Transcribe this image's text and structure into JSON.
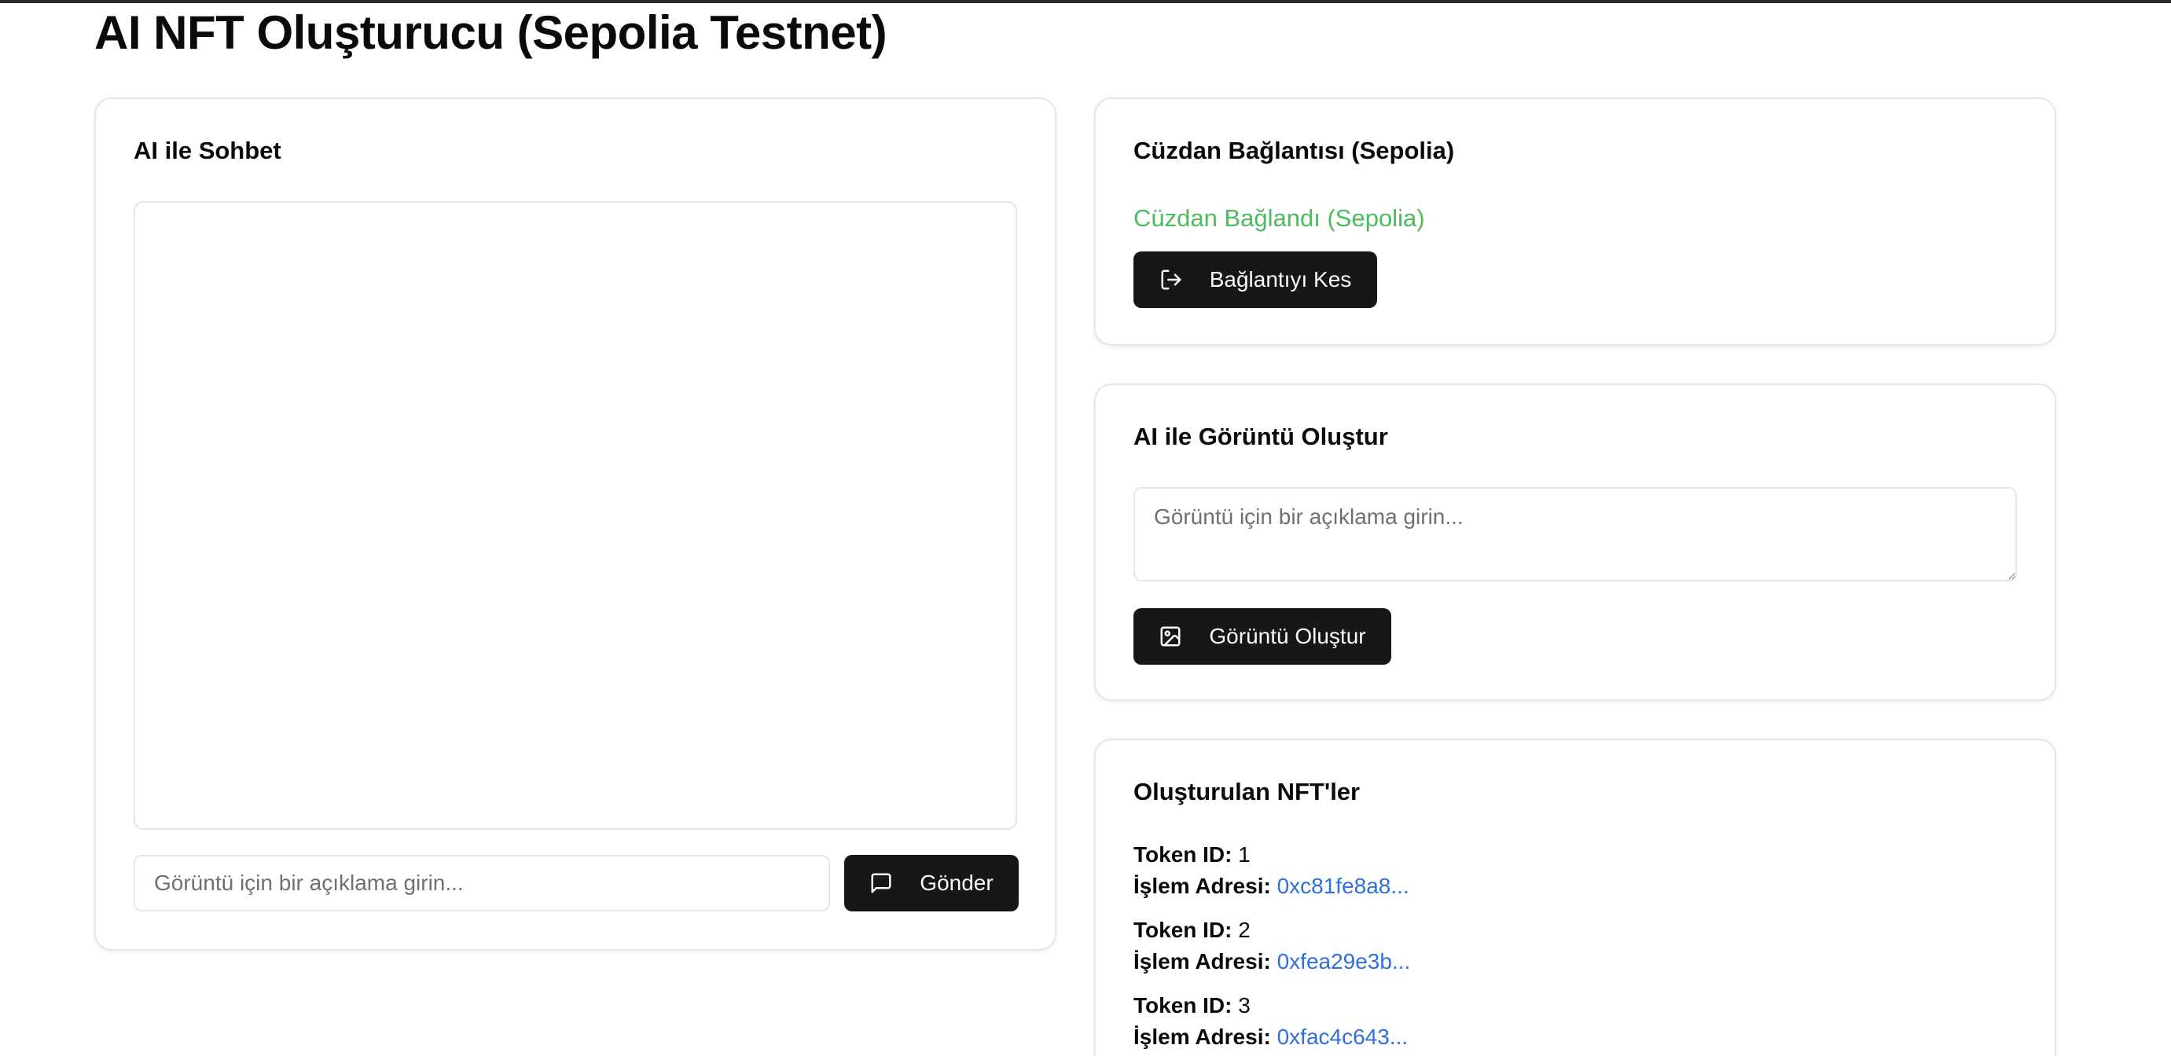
{
  "page": {
    "title": "AI NFT Oluşturucu (Sepolia Testnet)"
  },
  "chat": {
    "title": "AI ile Sohbet",
    "input_placeholder": "Görüntü için bir açıklama girin...",
    "send_label": "Gönder",
    "send_icon": "message-square-icon"
  },
  "wallet": {
    "title": "Cüzdan Bağlantısı (Sepolia)",
    "status": "Cüzdan Bağlandı (Sepolia)",
    "status_color": "#4cbb5f",
    "disconnect_label": "Bağlantıyı Kes",
    "disconnect_icon": "log-out-icon"
  },
  "image_gen": {
    "title": "AI ile Görüntü Oluştur",
    "prompt_placeholder": "Görüntü için bir açıklama girin...",
    "generate_label": "Görüntü Oluştur",
    "generate_icon": "image-icon"
  },
  "nfts": {
    "title": "Oluşturulan NFT'ler",
    "token_label": "Token ID:",
    "tx_label": "İşlem Adresi:",
    "items": [
      {
        "token_id": "1",
        "tx": "0xc81fe8a8..."
      },
      {
        "token_id": "2",
        "tx": "0xfea29e3b..."
      },
      {
        "token_id": "3",
        "tx": "0xfac4c643..."
      }
    ]
  },
  "colors": {
    "button_bg": "#171717",
    "link": "#2f6fdb",
    "card_border": "#e5e5e5"
  }
}
